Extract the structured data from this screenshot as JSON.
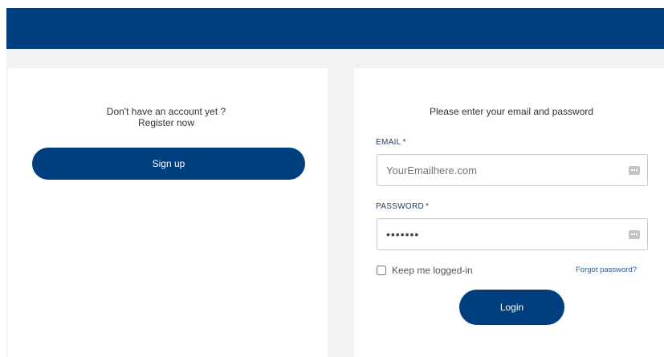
{
  "register": {
    "line1": "Don't have an account yet ?",
    "line2": "Register now",
    "signup_label": "Sign up"
  },
  "login": {
    "heading": "Please enter your email and password",
    "email_label": "EMAIL",
    "email_required": "*",
    "email_placeholder": "YourEmailhere.com",
    "password_label": "PASSWORD",
    "password_required": "*",
    "password_value": "•••••••",
    "remember_label": "Keep me logged-in",
    "forgot_label": "Forgot password?",
    "login_label": "Login"
  },
  "colors": {
    "brand": "#003f7f",
    "page_background": "#f2f2f2",
    "panel": "#ffffff"
  },
  "icons": {
    "field_icon": "password-manager-key-icon"
  }
}
